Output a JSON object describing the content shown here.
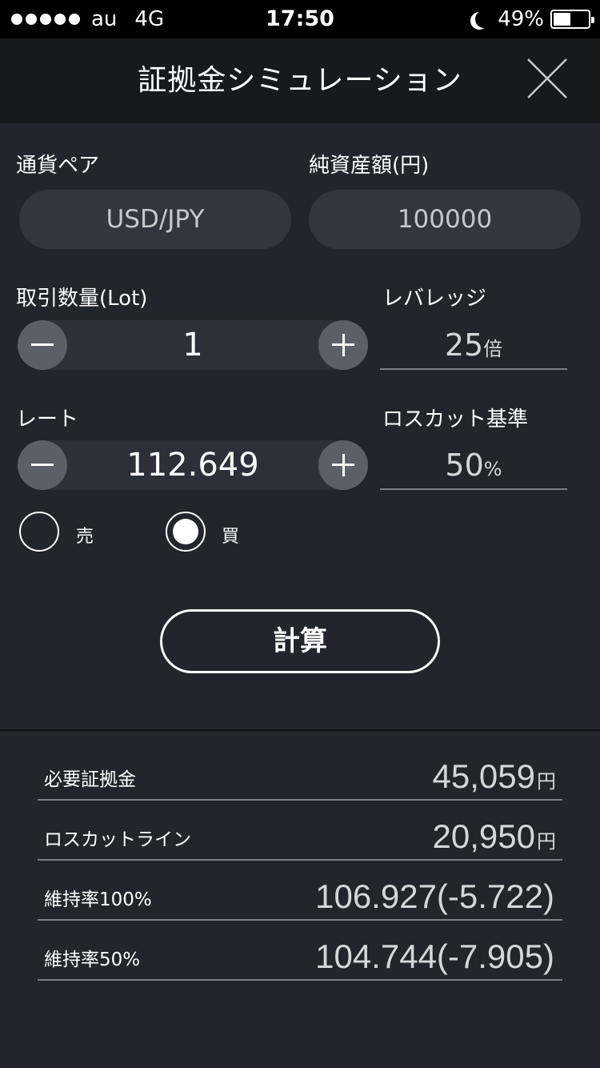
{
  "status_bar": {
    "carrier": "au",
    "network": "4G",
    "time": "17:50",
    "battery": "49%",
    "battery_level": 0.49
  },
  "header": {
    "title": "証拠金シミュレーション"
  },
  "form": {
    "currency_pair_label": "通貨ペア",
    "currency_pair_value": "USD/JPY",
    "net_assets_label": "純資産額(円)",
    "net_assets_value": "100000",
    "lot_label": "取引数量(Lot)",
    "lot_value": "1",
    "leverage_label": "レバレッジ",
    "leverage_value": "25",
    "leverage_unit": "倍",
    "rate_label": "レート",
    "rate_value": "112.649",
    "losscut_label": "ロスカット基準",
    "losscut_value": "50",
    "losscut_unit": "%",
    "sell_label": "売",
    "buy_label": "買",
    "selected_side": "buy",
    "calculate_label": "計算"
  },
  "results": [
    {
      "label": "必要証拠金",
      "value": "45,059",
      "unit": "円"
    },
    {
      "label": "ロスカットライン",
      "value": "20,950",
      "unit": "円"
    },
    {
      "label": "維持率100%",
      "value": "106.927(-5.722)",
      "unit": ""
    },
    {
      "label": "維持率50%",
      "value": "104.744(-7.905)",
      "unit": ""
    }
  ]
}
